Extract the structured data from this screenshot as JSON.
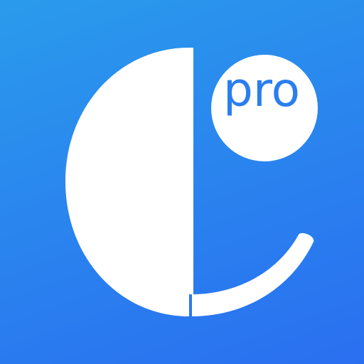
{
  "app_icon": {
    "badge_text": "pro",
    "logo_icon": "c-letter-logo-icon",
    "colors": {
      "background_top": "#2a9bec",
      "background_bottom": "#2a6ff0",
      "logo": "#ffffff",
      "badge": "#ffffff",
      "badge_text": "#2a7ef0"
    }
  }
}
